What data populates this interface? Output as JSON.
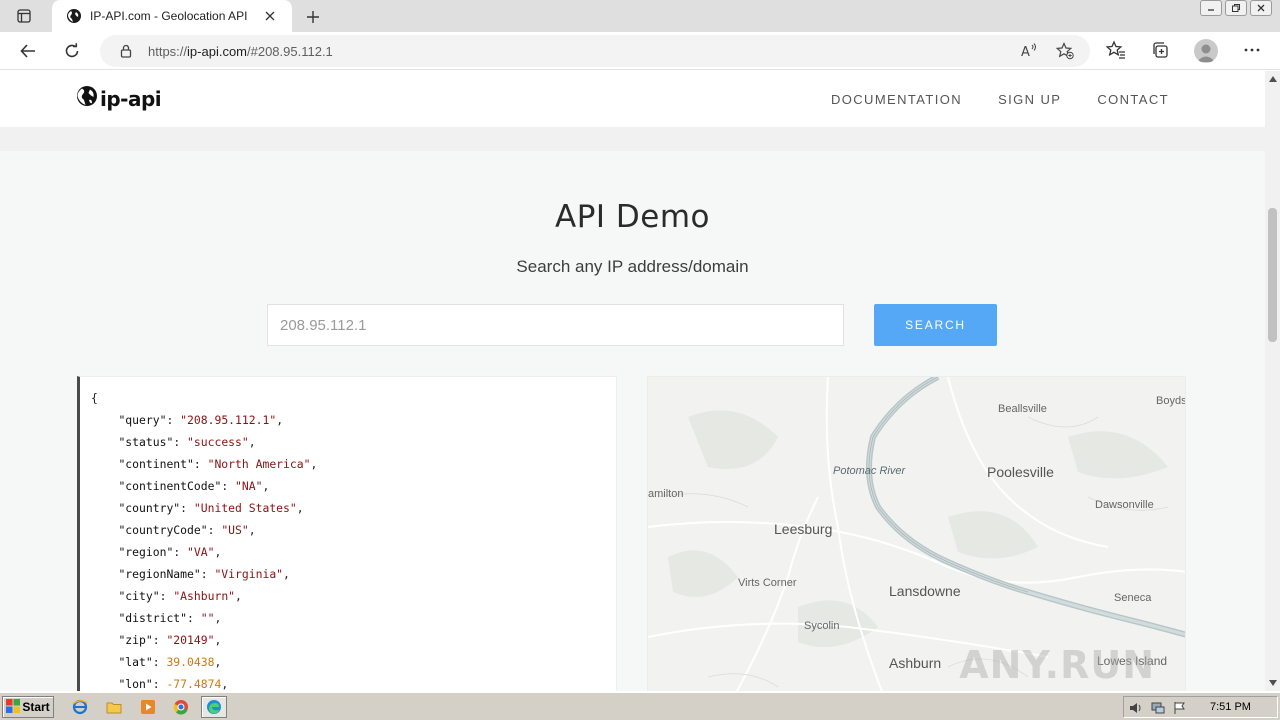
{
  "browser": {
    "tab_title": "IP-API.com - Geolocation API",
    "url_prefix": "https://",
    "url_host": "ip-api.com",
    "url_rest": "/#208.95.112.1"
  },
  "site": {
    "logo_text": "ip-api",
    "nav": [
      "DOCUMENTATION",
      "SIGN UP",
      "CONTACT"
    ]
  },
  "demo": {
    "title": "API Demo",
    "subtitle": "Search any IP address/domain",
    "search_value": "208.95.112.1",
    "search_button": "SEARCH"
  },
  "json": {
    "open_brace": "{",
    "fields": [
      {
        "key": "\"query\"",
        "value": "\"208.95.112.1\"",
        "type": "string"
      },
      {
        "key": "\"status\"",
        "value": "\"success\"",
        "type": "string"
      },
      {
        "key": "\"continent\"",
        "value": "\"North America\"",
        "type": "string"
      },
      {
        "key": "\"continentCode\"",
        "value": "\"NA\"",
        "type": "string"
      },
      {
        "key": "\"country\"",
        "value": "\"United States\"",
        "type": "string"
      },
      {
        "key": "\"countryCode\"",
        "value": "\"US\"",
        "type": "string"
      },
      {
        "key": "\"region\"",
        "value": "\"VA\"",
        "type": "string"
      },
      {
        "key": "\"regionName\"",
        "value": "\"Virginia\"",
        "type": "string"
      },
      {
        "key": "\"city\"",
        "value": "\"Ashburn\"",
        "type": "string"
      },
      {
        "key": "\"district\"",
        "value": "\"\"",
        "type": "string"
      },
      {
        "key": "\"zip\"",
        "value": "\"20149\"",
        "type": "string"
      },
      {
        "key": "\"lat\"",
        "value": "39.0438",
        "type": "number"
      },
      {
        "key": "\"lon\"",
        "value": "-77.4874",
        "type": "number"
      }
    ]
  },
  "map": {
    "labels": {
      "bealls": "Beallsville",
      "boyds": "Boyds",
      "potomac": "Potomac River",
      "poolesville": "Poolesville",
      "hamilton": "amilton",
      "dawsonville": "Dawsonville",
      "leesburg": "Leesburg",
      "virts": "Virts Corner",
      "lansdowne": "Lansdowne",
      "seneca": "Seneca",
      "sycolin": "Sycolin",
      "ashburn": "Ashburn",
      "lowes": "Lowes Island"
    },
    "watermark": "ANY.RUN"
  },
  "taskbar": {
    "start": "Start",
    "clock": "7:51 PM"
  },
  "colors": {
    "search_button": "#55a8f5",
    "json_string": "#8a1212",
    "json_number": "#c97c10"
  }
}
